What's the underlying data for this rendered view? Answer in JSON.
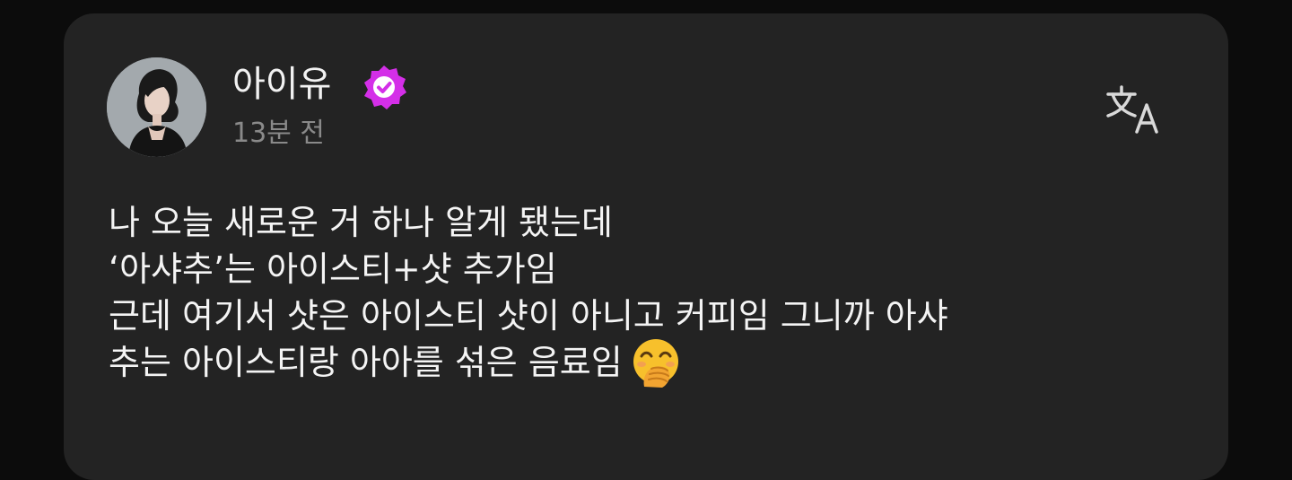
{
  "post": {
    "author": {
      "name": "아이유",
      "verified": true,
      "verified_color": "#d42fe8",
      "avatar_icon": "profile-photo"
    },
    "time_ago": "13분 전",
    "translate_icon": "translate-icon",
    "lines": [
      "나 오늘 새로운 거 하나 알게 됐는데",
      "‘아샤추’는 아이스티+샷 추가임",
      "근데 여기서 샷은 아이스티 샷이 아니고 커피임 그니까 아샤",
      "추는 아이스티랑 아아를 섞은 음료임"
    ],
    "emoji": "🤭",
    "emoji_icon": "face-with-hand-over-mouth-emoji"
  },
  "colors": {
    "background": "#0c0c0c",
    "card": "#232323",
    "text": "#f4f4f4",
    "muted_text": "#8a8a8a",
    "verified_badge": "#d42fe8"
  }
}
